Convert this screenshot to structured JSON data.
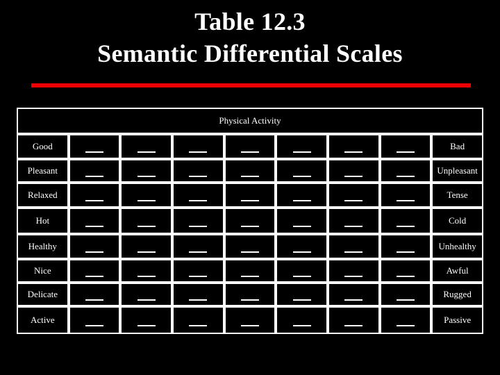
{
  "title": {
    "line1": "Table 12.3",
    "line2": "Semantic Differential Scales",
    "rule_color": "#ee0000"
  },
  "table": {
    "header": "Physical Activity",
    "scale_points": 7,
    "mark_glyph": "underscore-mark",
    "rows": [
      {
        "left": "Good",
        "right": "Bad"
      },
      {
        "left": "Pleasant",
        "right": "Unpleasant"
      },
      {
        "left": "Relaxed",
        "right": "Tense"
      },
      {
        "left": "Hot",
        "right": "Cold"
      },
      {
        "left": "Healthy",
        "right": "Unhealthy"
      },
      {
        "left": "Nice",
        "right": "Awful"
      },
      {
        "left": "Delicate",
        "right": "Rugged"
      },
      {
        "left": "Active",
        "right": "Passive"
      }
    ]
  },
  "theme": {
    "background": "#000000",
    "text": "#ffffff",
    "border": "#ffffff"
  }
}
